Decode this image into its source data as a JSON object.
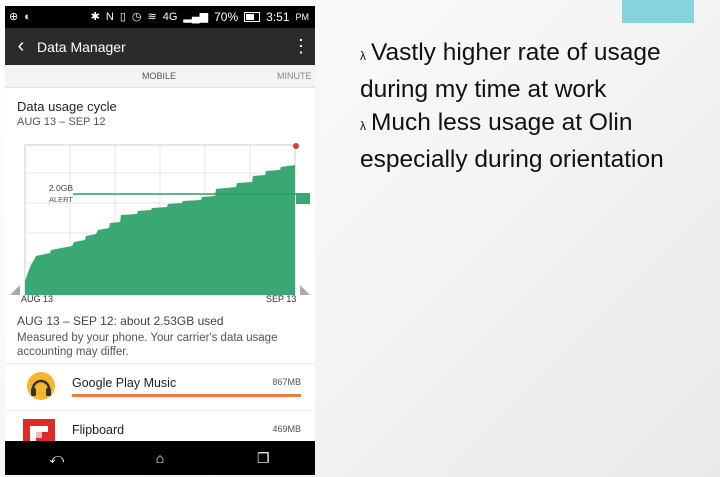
{
  "status_bar": {
    "battery": "70%",
    "time": "3:51",
    "ampm": "PM"
  },
  "app_bar": {
    "title": "Data Manager"
  },
  "tabs": {
    "active": "MOBILE",
    "next": "MINUTE"
  },
  "cycle": {
    "title": "Data usage cycle",
    "dates": "AUG 13 – SEP 12",
    "alert_value": "2.0GB",
    "alert_label": "ALERT",
    "axis_start": "AUG 13",
    "axis_end": "SEP 13",
    "summary": "AUG 13 – SEP 12: about 2.53GB used",
    "note": "Measured by your phone. Your carrier's data usage accounting may differ."
  },
  "apps": [
    {
      "name": "Google Play Music",
      "size": "867MB",
      "usage_fraction": 1.0
    },
    {
      "name": "Flipboard",
      "size": "469MB"
    }
  ],
  "bullets": [
    {
      "marker": "λ",
      "line1": "Vastly higher rate of usage",
      "line2": "during my time at work"
    },
    {
      "marker": "λ",
      "line1": "Much less usage at Olin",
      "line2": "especially during orientation"
    }
  ],
  "colors": {
    "usage_fill": "#3aa872",
    "app_bar": "#f07a3b",
    "accent_box": "#86d3e0"
  }
}
